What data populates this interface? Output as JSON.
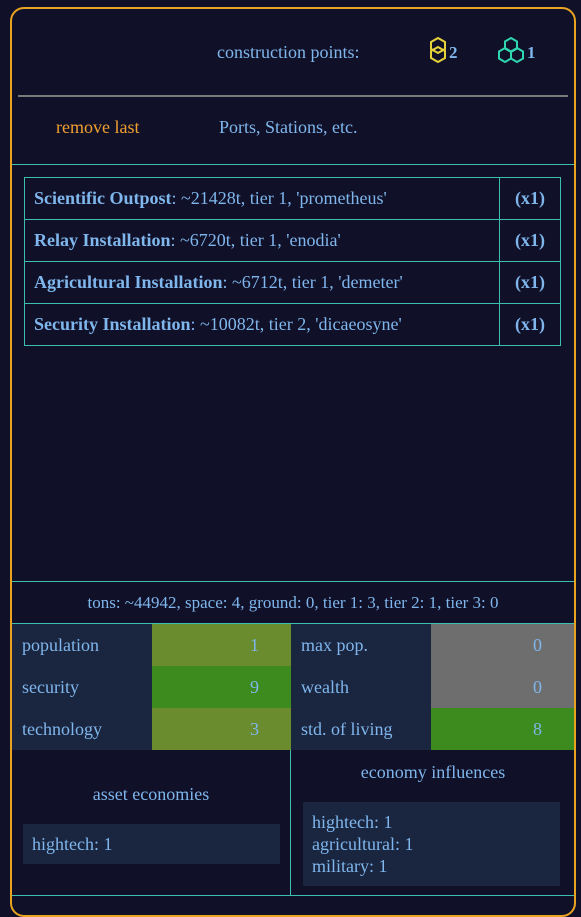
{
  "header": {
    "construction_points_label": "construction points:",
    "yellow_points": "2",
    "teal_points": "1"
  },
  "actions": {
    "remove_last": "remove last",
    "ports_stations": "Ports, Stations, etc."
  },
  "installations": [
    {
      "name": "Scientific Outpost",
      "details": ": ~21428t, tier 1, 'prometheus'",
      "count": "(x1)"
    },
    {
      "name": "Relay Installation",
      "details": ": ~6720t, tier 1, 'enodia'",
      "count": "(x1)"
    },
    {
      "name": "Agricultural Installation",
      "details": ": ~6712t, tier 1, 'demeter'",
      "count": "(x1)"
    },
    {
      "name": "Security Installation",
      "details": ": ~10082t, tier 2, 'dicaeosyne'",
      "count": "(x1)"
    }
  ],
  "totals": "tons: ~44942, space: 4, ground: 0, tier 1: 3, tier 2: 1, tier 3: 0",
  "stats": {
    "population": {
      "label": "population",
      "value": "1"
    },
    "max_pop": {
      "label": "max pop.",
      "value": "0"
    },
    "security": {
      "label": "security",
      "value": "9"
    },
    "wealth": {
      "label": "wealth",
      "value": "0"
    },
    "technology": {
      "label": "technology",
      "value": "3"
    },
    "std_of_living": {
      "label": "std. of living",
      "value": "8"
    }
  },
  "colors": {
    "olive": "#6b8c2e",
    "green": "#3d8a1e",
    "grey": "#6e6e6e",
    "accent_orange": "#e8a421",
    "teal_border": "#3bbfb0"
  },
  "economies": {
    "asset_heading": "asset economies",
    "asset_lines": [
      "hightech: 1"
    ],
    "influence_heading": "economy influences",
    "influence_lines": [
      "hightech: 1",
      "agricultural: 1",
      "military: 1"
    ]
  }
}
